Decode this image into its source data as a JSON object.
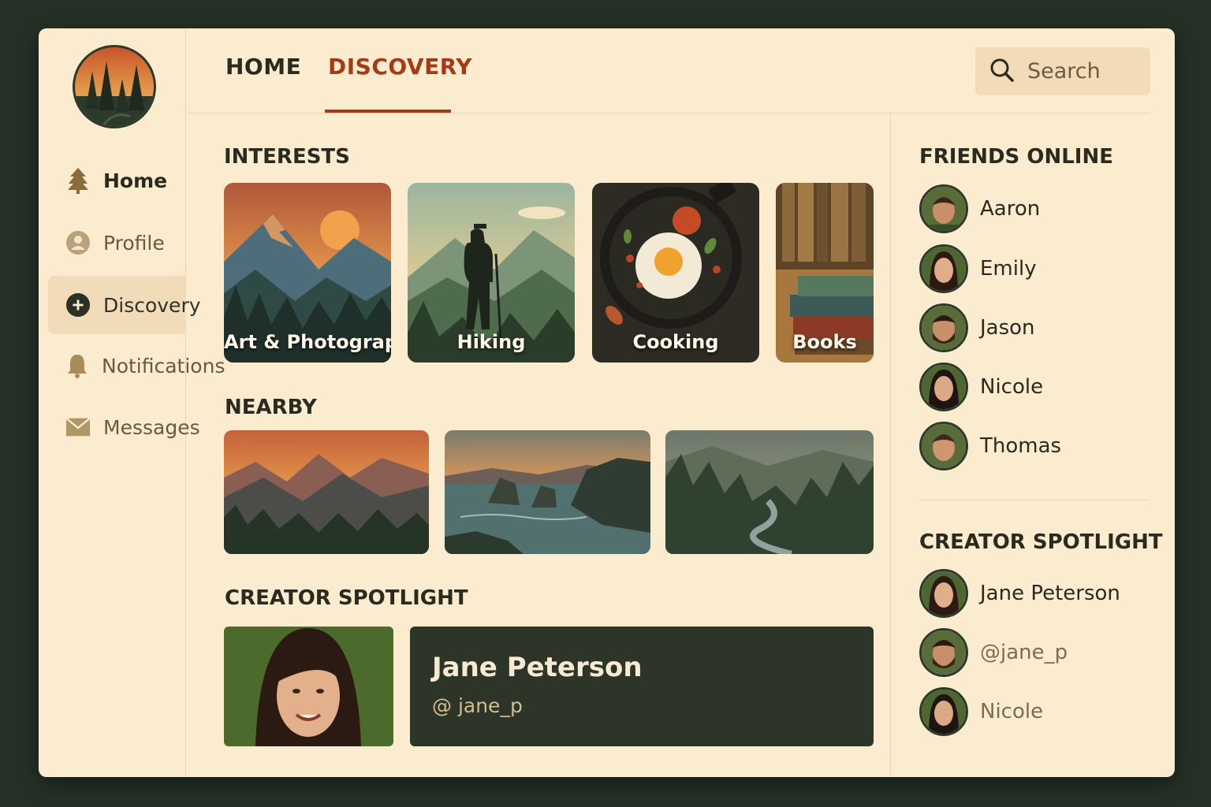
{
  "sidebar": {
    "items": [
      {
        "label": "Home",
        "icon": "tree-icon"
      },
      {
        "label": "Profile",
        "icon": "user-icon"
      },
      {
        "label": "Discovery",
        "icon": "plus-circle-icon"
      },
      {
        "label": "Notifications",
        "icon": "bell-icon"
      },
      {
        "label": "Messages",
        "icon": "envelope-icon"
      }
    ]
  },
  "header": {
    "tabs": [
      {
        "label": "HOME"
      },
      {
        "label": "DISCOVERY"
      }
    ],
    "search_placeholder": "Search"
  },
  "main": {
    "interests_title": "INTERESTS",
    "interests": [
      {
        "label": "Art & Photography"
      },
      {
        "label": "Hiking"
      },
      {
        "label": "Cooking"
      },
      {
        "label": "Books"
      }
    ],
    "nearby_title": "NEARBY",
    "spotlight_title": "CREATOR SPOTLIGHT",
    "spotlight": {
      "name": "Jane Peterson",
      "handle": "@ jane_p"
    }
  },
  "right": {
    "friends_title": "FRIENDS ONLINE",
    "friends": [
      "Aaron",
      "Emily",
      "Jason",
      "Nicole",
      "Thomas"
    ],
    "spotlight_title": "CREATOR SPOTLIGHT",
    "spotlight_list": [
      "Jane Peterson",
      "@jane_p",
      "Nicole"
    ]
  },
  "colors": {
    "background": "#253126",
    "panel": "#fbecd0",
    "accent": "#a63a17",
    "dark_card": "#2d3528"
  }
}
